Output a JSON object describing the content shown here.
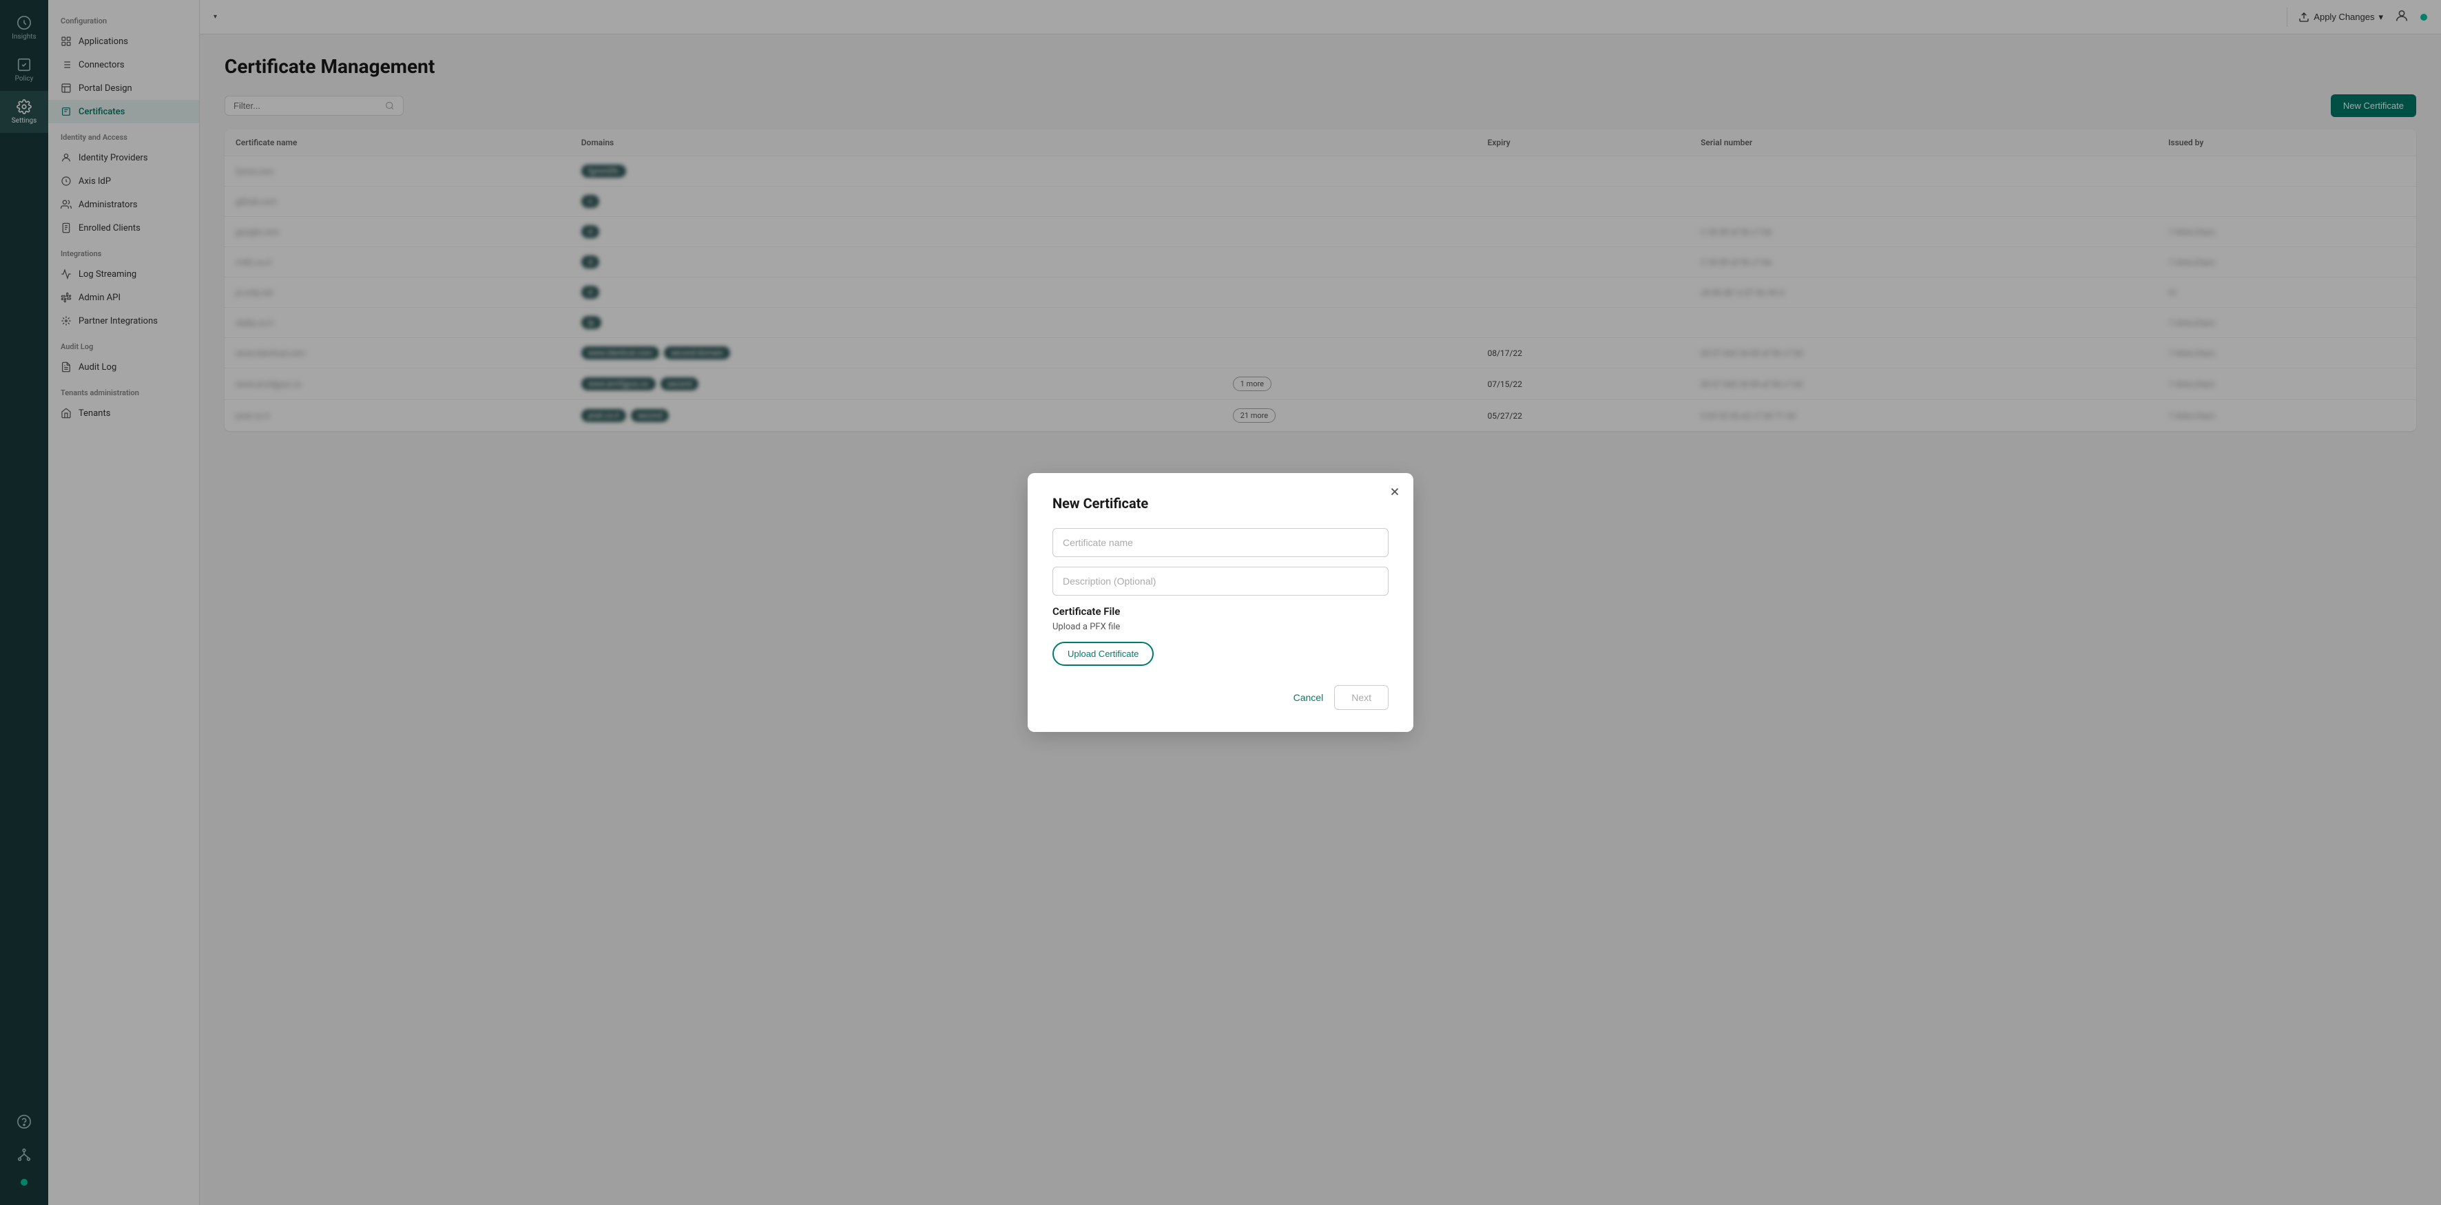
{
  "iconSidebar": {
    "items": [
      {
        "id": "insights",
        "label": "Insights",
        "active": false
      },
      {
        "id": "policy",
        "label": "Policy",
        "active": false
      },
      {
        "id": "settings",
        "label": "Settings",
        "active": true
      }
    ],
    "bottomItems": [
      {
        "id": "help",
        "label": "Help"
      },
      {
        "id": "network",
        "label": "Network"
      }
    ]
  },
  "navSidebar": {
    "sections": [
      {
        "label": "Configuration",
        "items": [
          {
            "id": "applications",
            "label": "Applications",
            "active": false
          },
          {
            "id": "connectors",
            "label": "Connectors",
            "active": false
          },
          {
            "id": "portal-design",
            "label": "Portal Design",
            "active": false
          },
          {
            "id": "certificates",
            "label": "Certificates",
            "active": true
          }
        ]
      },
      {
        "label": "Identity and Access",
        "items": [
          {
            "id": "identity-providers",
            "label": "Identity Providers",
            "active": false
          },
          {
            "id": "axis-idp",
            "label": "Axis IdP",
            "active": false
          },
          {
            "id": "administrators",
            "label": "Administrators",
            "active": false
          },
          {
            "id": "enrolled-clients",
            "label": "Enrolled Clients",
            "active": false
          }
        ]
      },
      {
        "label": "Integrations",
        "items": [
          {
            "id": "log-streaming",
            "label": "Log Streaming",
            "active": false
          },
          {
            "id": "admin-api",
            "label": "Admin API",
            "active": false
          },
          {
            "id": "partner-integrations",
            "label": "Partner Integrations",
            "active": false
          }
        ]
      },
      {
        "label": "Audit Log",
        "items": [
          {
            "id": "audit-log",
            "label": "Audit Log",
            "active": false
          }
        ]
      },
      {
        "label": "Tenants administration",
        "items": [
          {
            "id": "tenants",
            "label": "Tenants",
            "active": false
          }
        ]
      }
    ]
  },
  "topbar": {
    "applyChanges": "Apply Changes",
    "dropdownArrow": "▾"
  },
  "page": {
    "title": "Certificate Management",
    "filter": {
      "placeholder": "Filter..."
    },
    "newCertButton": "New Certificate",
    "table": {
      "columns": [
        "Certificate name",
        "Domains",
        "",
        "Expiry",
        "Serial number",
        "Issued by"
      ],
      "rows": [
        {
          "name": "fynva.com",
          "domains": [
            "fgmm0fc"
          ],
          "domainExtra": null,
          "expiry": "",
          "serial": "",
          "issuedBy": ""
        },
        {
          "name": "github.com",
          "domains": [
            "n"
          ],
          "domainExtra": null,
          "expiry": "",
          "serial": "",
          "issuedBy": ""
        },
        {
          "name": "google.com",
          "domains": [
            "d"
          ],
          "domainExtra": null,
          "expiry": "",
          "serial": "C 36 89 af 96 c7 bb",
          "issuedBy": "7 dots/chars"
        },
        {
          "name": "rn4lc.co.il",
          "domains": [
            "d"
          ],
          "domainExtra": null,
          "expiry": "",
          "serial": "C 36 89 af 96 c7 bb",
          "issuedBy": "7 dots/chars"
        },
        {
          "name": "pi.only.net",
          "domains": [
            "d"
          ],
          "domainExtra": null,
          "expiry": "",
          "serial": "c8 68 d8 1c:07 8c 49 A",
          "issuedBy": "01"
        },
        {
          "name": "stella.co.il",
          "domains": [
            "lp"
          ],
          "domainExtra": null,
          "expiry": "",
          "serial": "",
          "issuedBy": "7 dots/chars"
        },
        {
          "name": "www.identical.com",
          "domains": [
            "www.identical.com",
            "second-domain"
          ],
          "domainExtra": null,
          "expiry": "08/17/22",
          "serial": "00 07 6d2 36 89 af 96 c7 b0",
          "issuedBy": "7 dots/chars"
        },
        {
          "name": "www.armfgyux.co",
          "domains": [
            "www.armfgyux.co",
            "second"
          ],
          "domainExtra": "1 more",
          "expiry": "07/15/22",
          "serial": "00 07 6d2 36 89 af 96 c7 b0",
          "issuedBy": "7 dots/chars"
        },
        {
          "name": "pnet.co.il",
          "domains": [
            "pnet.co.il",
            "second"
          ],
          "domainExtra": "21 more",
          "expiry": "05/27/22",
          "serial": "0 69 52 06 a2 c7 60 71 6d",
          "issuedBy": "7 dots/chars"
        }
      ]
    }
  },
  "modal": {
    "title": "New Certificate",
    "certNamePlaceholder": "Certificate name",
    "descriptionPlaceholder": "Description (Optional)",
    "certFileLabel": "Certificate File",
    "certFileSub": "Upload a PFX file",
    "uploadButton": "Upload Certificate",
    "cancelButton": "Cancel",
    "nextButton": "Next"
  }
}
